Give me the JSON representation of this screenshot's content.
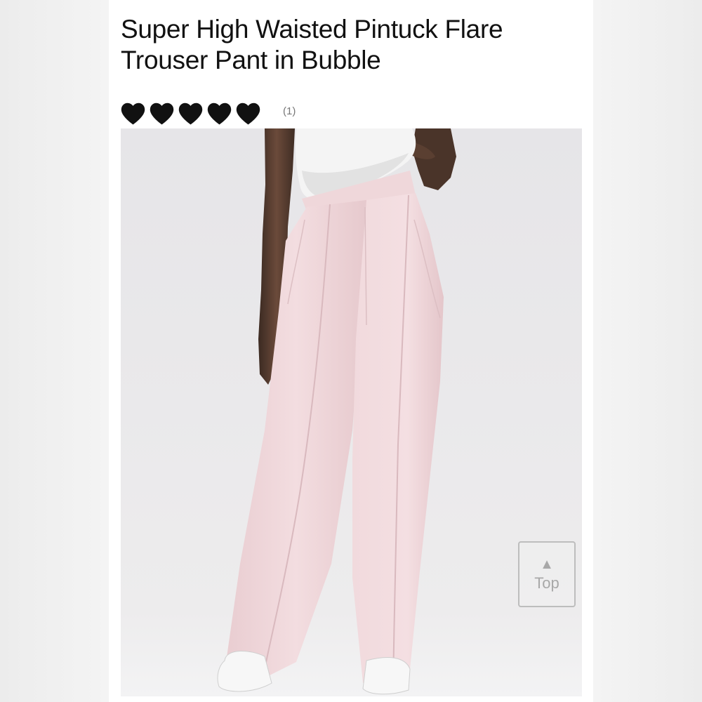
{
  "product": {
    "title": "Super High Waisted Pintuck Flare Trouser Pant in Bubble",
    "rating": {
      "stars": 5,
      "max": 5,
      "review_count": "(1)"
    }
  },
  "image": {
    "description_icon": "product-photo"
  },
  "scroll_top": {
    "arrow": "▲",
    "label": "Top"
  },
  "colors": {
    "heart": "#111111",
    "pant": "#f0d6d9",
    "background": "#e9e8ea"
  }
}
